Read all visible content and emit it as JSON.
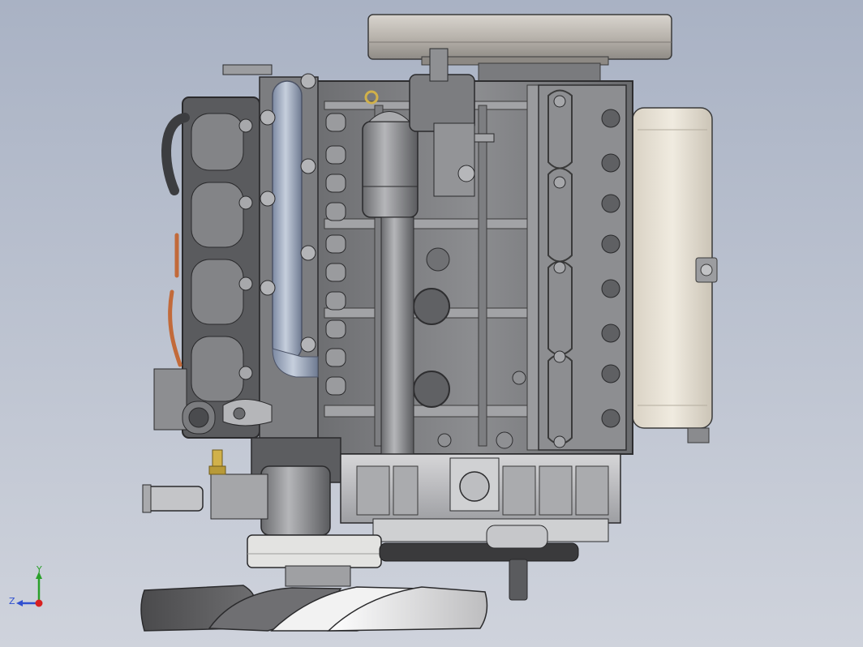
{
  "viewport": {
    "model": "engine-assembly",
    "view": "side-orthographic",
    "background_top": "#a9b2c4",
    "background_bottom": "#cfd3dc"
  },
  "colors": {
    "metal_dark": "#5c5d60",
    "metal_mid": "#8a8b8e",
    "metal_light": "#c9c9cb",
    "highlight": "#efefef",
    "pulley": "#bdb8b2",
    "blue_manifold": "#9aa8c0",
    "copper": "#c26a3a",
    "brass": "#d1b14a",
    "fan_dark": "#4a4a4c",
    "fan_light": "#e8e8e8",
    "belt": "#3a3a3c"
  },
  "triad": {
    "x_color": "#d82020",
    "y_color": "#2aa02a",
    "z_color": "#3050d0",
    "y_label": "Y",
    "z_label": "Z"
  }
}
